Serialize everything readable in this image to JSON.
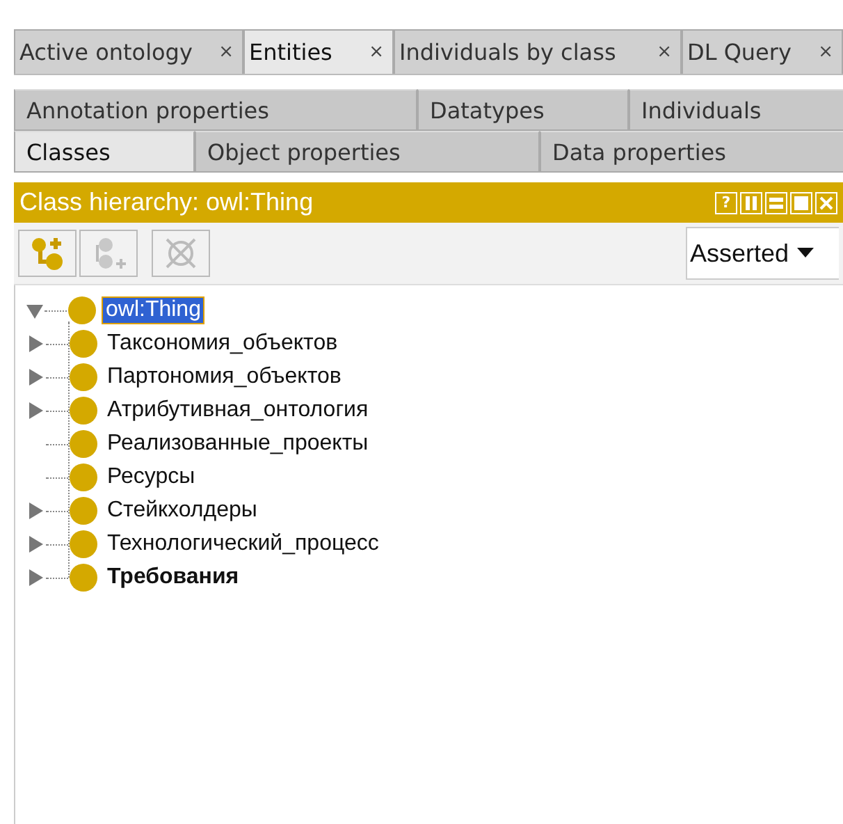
{
  "tabs": [
    {
      "label": "Active ontology",
      "close": "×",
      "selected": false
    },
    {
      "label": "Entities",
      "close": "×",
      "selected": true
    },
    {
      "label": "Individuals by class",
      "close": "×",
      "selected": false
    },
    {
      "label": "DL Query",
      "close": "×",
      "selected": false
    }
  ],
  "entity_tabs": [
    [
      {
        "label": "Annotation properties",
        "selected": false
      },
      {
        "label": "Datatypes",
        "selected": false
      },
      {
        "label": "Individuals",
        "selected": false
      }
    ],
    [
      {
        "label": "Classes",
        "selected": true
      },
      {
        "label": "Object properties",
        "selected": false
      },
      {
        "label": "Data properties",
        "selected": false
      }
    ]
  ],
  "view": {
    "title": "Class hierarchy: owl:Thing",
    "help": "?"
  },
  "toolbar": {
    "buttons": [
      {
        "kind": "add-subclass",
        "disabled": false
      },
      {
        "kind": "add-sibling",
        "disabled": true
      },
      {
        "kind": "delete",
        "disabled": true
      }
    ],
    "mode": "Asserted"
  },
  "tree": [
    {
      "label": "owl:Thing",
      "selected": true,
      "expanded": true,
      "bold": false,
      "children": [
        {
          "label": "Таксономия_объектов",
          "selected": false,
          "has_children": true,
          "bold": false
        },
        {
          "label": "Партономия_объектов",
          "selected": false,
          "has_children": true,
          "bold": false
        },
        {
          "label": "Атрибутивная_онтология",
          "selected": false,
          "has_children": true,
          "bold": false
        },
        {
          "label": "Реализованные_проекты",
          "selected": false,
          "has_children": false,
          "bold": false
        },
        {
          "label": "Ресурсы",
          "selected": false,
          "has_children": false,
          "bold": false
        },
        {
          "label": "Стейкхолдеры",
          "selected": false,
          "has_children": true,
          "bold": false
        },
        {
          "label": "Технологический_процесс",
          "selected": false,
          "has_children": true,
          "bold": false
        },
        {
          "label": "Требования",
          "selected": false,
          "has_children": true,
          "bold": true
        }
      ]
    }
  ]
}
